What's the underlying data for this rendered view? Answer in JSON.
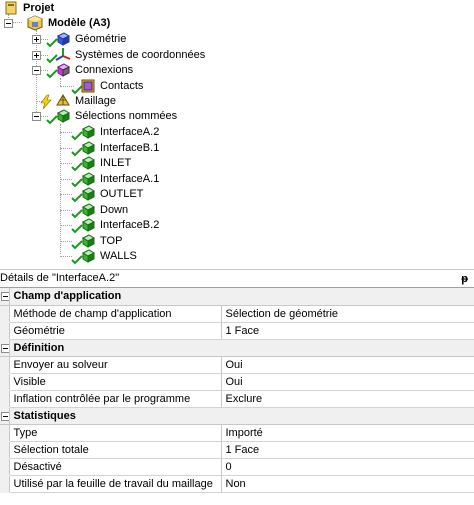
{
  "tree": {
    "project": "Projet",
    "model": "Modèle (A3)",
    "geometry": "Géométrie",
    "coordinate_systems": "Systèmes de coordonnées",
    "connections": "Connexions",
    "contacts": "Contacts",
    "mesh": "Maillage",
    "named_selections": "Sélections nommées",
    "selections": [
      "InterfaceA.2",
      "InterfaceB.1",
      "INLET",
      "InterfaceA.1",
      "OUTLET",
      "Down",
      "InterfaceB.2",
      "TOP",
      "WALLS"
    ]
  },
  "details": {
    "title": "Détails de \"InterfaceA.2\"",
    "pin": "ᵽ",
    "categories": [
      {
        "name": "Champ d'application",
        "rows": [
          {
            "key": "Méthode de champ d'application",
            "value": "Sélection de géométrie"
          },
          {
            "key": "Géométrie",
            "value": "1 Face"
          }
        ]
      },
      {
        "name": "Définition",
        "rows": [
          {
            "key": "Envoyer au solveur",
            "value": "Oui"
          },
          {
            "key": "Visible",
            "value": "Oui"
          },
          {
            "key": "Inflation contrôlée par le programme",
            "value": "Exclure"
          }
        ]
      },
      {
        "name": "Statistiques",
        "rows": [
          {
            "key": "Type",
            "value": "Importé"
          },
          {
            "key": "Sélection totale",
            "value": "1 Face"
          },
          {
            "key": "Désactivé",
            "value": "0"
          },
          {
            "key": "Utilisé par la feuille de travail du maillage",
            "value": "Non"
          }
        ]
      }
    ]
  }
}
